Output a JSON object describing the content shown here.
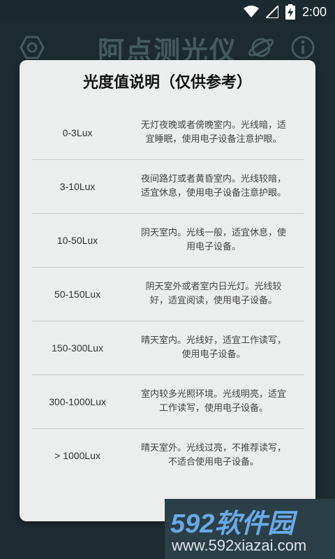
{
  "status_bar": {
    "time": "2:00"
  },
  "app": {
    "title": "阿点测光仪"
  },
  "dialog": {
    "title": "光度值说明（仅供参考）",
    "rows": [
      {
        "range": "0-3Lux",
        "desc_l1": "无灯夜晚或者傍晚室内。光线暗，适",
        "desc_l2": "宜睡眠，使用电子设备注意护眼。"
      },
      {
        "range": "3-10Lux",
        "desc_l1": "夜间路灯或者黄昏室内。光线较暗，",
        "desc_l2": "适宜休息，使用电子设备注意护眼。"
      },
      {
        "range": "10-50Lux",
        "desc_l1": "阴天室内。光线一般，适宜休息，使",
        "desc_l2": "用电子设备。"
      },
      {
        "range": "50-150Lux",
        "desc_l1": "阴天室外或者室内日光灯。光线较",
        "desc_l2": "好，适宜阅读，使用电子设备。"
      },
      {
        "range": "150-300Lux",
        "desc_l1": "晴天室内。光线好，适宜工作读写，",
        "desc_l2": "使用电子设备。"
      },
      {
        "range": "300-1000Lux",
        "desc_l1": "室内较多光照环境。光线明亮，适宜",
        "desc_l2": "工作读写，使用电子设备。"
      },
      {
        "range": "> 1000Lux",
        "desc_l1": "晴天室外。光线过亮，不推荐读写，",
        "desc_l2": "不适合使用电子设备。"
      }
    ]
  },
  "watermark": {
    "brand": "592软件园",
    "url": "www.592xiazai.com"
  },
  "icons": [
    "wifi-icon",
    "signal-icon",
    "battery-charging-icon",
    "settings-hexagon-icon",
    "planet-icon",
    "info-icon"
  ]
}
